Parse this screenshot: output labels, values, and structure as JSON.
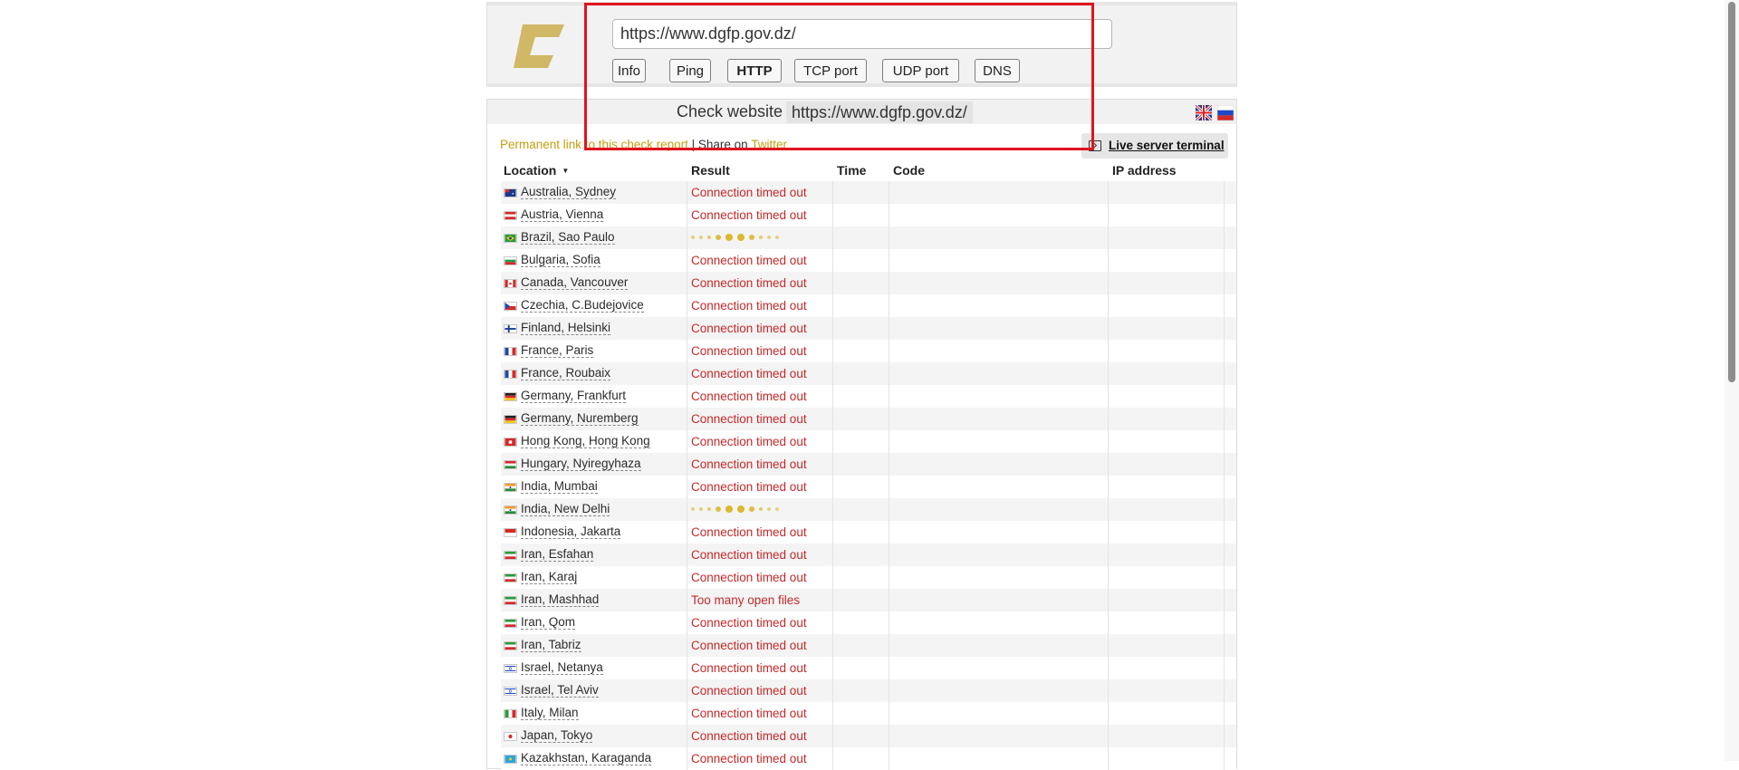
{
  "header": {
    "url_value": "https://www.dgfp.gov.dz/",
    "tabs": [
      "Info",
      "Ping",
      "HTTP",
      "TCP port",
      "UDP port",
      "DNS"
    ],
    "active_tab": "HTTP",
    "logo_color": "#d1b867"
  },
  "panel": {
    "check_label": "Check website",
    "check_url": "https://www.dgfp.gov.dz/",
    "permalink_text": "Permanent link to this check report",
    "separator": " | ",
    "share_text": "Share on ",
    "twitter_text": "Twitter",
    "terminal_label": "Live server terminal",
    "languages": [
      "uk-flag-icon",
      "ru-flag-icon"
    ]
  },
  "table": {
    "columns": {
      "location": "Location",
      "result": "Result",
      "time": "Time",
      "code": "Code",
      "ip": "IP address"
    },
    "rows": [
      {
        "location": "Australia, Sydney",
        "result": "Connection timed out",
        "flag": "au"
      },
      {
        "location": "Austria, Vienna",
        "result": "Connection timed out",
        "flag": "at"
      },
      {
        "location": "Brazil, Sao Paulo",
        "result": "",
        "pending": true,
        "flag": "br"
      },
      {
        "location": "Bulgaria, Sofia",
        "result": "Connection timed out",
        "flag": "bg"
      },
      {
        "location": "Canada, Vancouver",
        "result": "Connection timed out",
        "flag": "ca"
      },
      {
        "location": "Czechia, C.Budejovice",
        "result": "Connection timed out",
        "flag": "cz"
      },
      {
        "location": "Finland, Helsinki",
        "result": "Connection timed out",
        "flag": "fi"
      },
      {
        "location": "France, Paris",
        "result": "Connection timed out",
        "flag": "fr"
      },
      {
        "location": "France, Roubaix",
        "result": "Connection timed out",
        "flag": "fr"
      },
      {
        "location": "Germany, Frankfurt",
        "result": "Connection timed out",
        "flag": "de"
      },
      {
        "location": "Germany, Nuremberg",
        "result": "Connection timed out",
        "flag": "de"
      },
      {
        "location": "Hong Kong, Hong Kong",
        "result": "Connection timed out",
        "flag": "hk"
      },
      {
        "location": "Hungary, Nyiregyhaza",
        "result": "Connection timed out",
        "flag": "hu"
      },
      {
        "location": "India, Mumbai",
        "result": "Connection timed out",
        "flag": "in"
      },
      {
        "location": "India, New Delhi",
        "result": "",
        "pending": true,
        "flag": "in"
      },
      {
        "location": "Indonesia, Jakarta",
        "result": "Connection timed out",
        "flag": "id"
      },
      {
        "location": "Iran, Esfahan",
        "result": "Connection timed out",
        "flag": "ir"
      },
      {
        "location": "Iran, Karaj",
        "result": "Connection timed out",
        "flag": "ir"
      },
      {
        "location": "Iran, Mashhad",
        "result": "Too many open files",
        "flag": "ir"
      },
      {
        "location": "Iran, Qom",
        "result": "Connection timed out",
        "flag": "ir"
      },
      {
        "location": "Iran, Tabriz",
        "result": "Connection timed out",
        "flag": "ir"
      },
      {
        "location": "Israel, Netanya",
        "result": "Connection timed out",
        "flag": "il"
      },
      {
        "location": "Israel, Tel Aviv",
        "result": "Connection timed out",
        "flag": "il"
      },
      {
        "location": "Italy, Milan",
        "result": "Connection timed out",
        "flag": "it"
      },
      {
        "location": "Japan, Tokyo",
        "result": "Connection timed out",
        "flag": "jp"
      },
      {
        "location": "Kazakhstan, Karaganda",
        "result": "Connection timed out",
        "flag": "kz"
      }
    ]
  },
  "colors": {
    "error": "#c62828",
    "gold": "#c39f11",
    "annotation": "#e0141e"
  }
}
